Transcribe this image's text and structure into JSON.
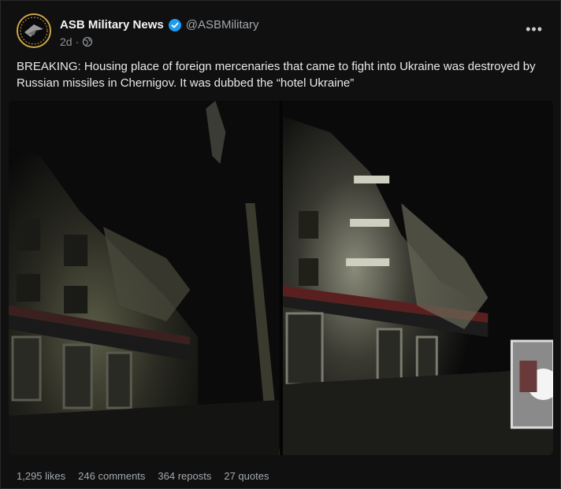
{
  "author": {
    "display_name": "ASB Military News",
    "handle": "@ASBMilitary",
    "time": "2d",
    "separator": "·"
  },
  "post": {
    "text": "BREAKING: Housing place of foreign mercenaries that came to fight into Ukraine was destroyed by Russian missiles in Chernigov. It was dubbed the “hotel Ukraine”"
  },
  "menu": {
    "more_label": "•••"
  },
  "media": {
    "photos": [
      "building-ruins-photo-left",
      "building-ruins-photo-right"
    ]
  },
  "stats": {
    "likes": "1,295 likes",
    "comments": "246 comments",
    "reposts": "364 reposts",
    "quotes": "27 quotes"
  },
  "colors": {
    "background": "#101010",
    "verified": "#1d9bf0",
    "avatar_ring": "#cfa64a"
  }
}
